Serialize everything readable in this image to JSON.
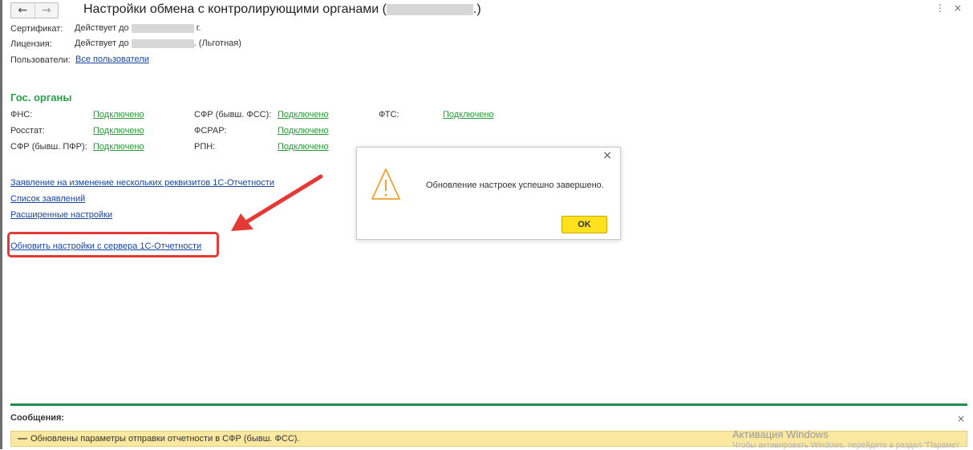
{
  "window": {
    "title_prefix": "Настройки обмена с контролирующими органами (",
    "title_suffix": ".)",
    "back_icon": "arrow-left-icon",
    "forward_icon": "arrow-right-icon",
    "more_glyph": "⋮",
    "close_glyph": "×"
  },
  "info": {
    "certificate_label": "Сертификат:",
    "certificate_value_prefix": "Действует до",
    "certificate_value_suffix": "г.",
    "license_label": "Лицензия:",
    "license_value_prefix": "Действует до",
    "license_value_suffix": ". (Льготная)",
    "users_label": "Пользователи:",
    "users_link": "Все пользователи"
  },
  "gov": {
    "section_title": "Гос. органы",
    "items": [
      {
        "label": "ФНС:",
        "status": "Подключено"
      },
      {
        "label": "Росстат:",
        "status": "Подключено"
      },
      {
        "label": "СФР (бывш. ПФР):",
        "status": "Подключено"
      },
      {
        "label": "СФР (бывш. ФСС):",
        "status": "Подключено"
      },
      {
        "label": "ФСРАР:",
        "status": "Подключено"
      },
      {
        "label": "РПН:",
        "status": "Подключено"
      },
      {
        "label": "ФТС:",
        "status": "Подключено"
      }
    ]
  },
  "links": {
    "change_requisites": "Заявление на изменение нескольких реквизитов 1С-Отчетности",
    "applications_list": "Список заявлений",
    "advanced_settings": "Расширенные настройки",
    "update_settings": "Обновить настройки с сервера 1С-Отчетности"
  },
  "dialog": {
    "message": "Обновление настроек успешно завершено.",
    "ok_label": "OK",
    "close_glyph": "×",
    "icon": "warning-triangle-icon"
  },
  "messages": {
    "title": "Сообщения:",
    "close_glyph": "×",
    "dash": "—",
    "text": "Обновлены параметры отправки отчетности в СФР (бывш. ФСС)."
  },
  "watermark": {
    "line1": "Активация Windows",
    "line2": "Чтобы активировать Windows, перейдите в раздел \"Парамет"
  },
  "colors": {
    "accent_green": "#2aa04a",
    "link_blue": "#1a46a0",
    "highlight_red": "#e53935",
    "ok_yellow": "#ffe11e",
    "message_bar": "#fbe8a0"
  }
}
